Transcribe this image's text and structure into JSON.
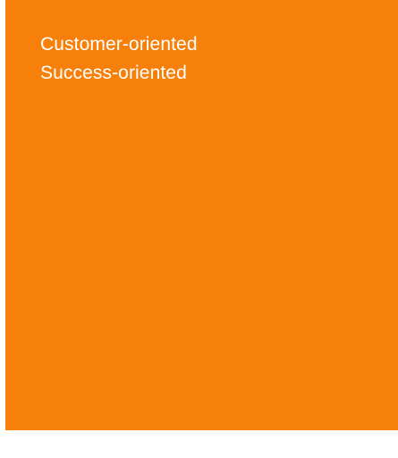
{
  "card": {
    "background_color": "#f7800a",
    "text_color": "#ffffff",
    "lines": [
      "Customer-oriented",
      "Success-oriented"
    ]
  }
}
